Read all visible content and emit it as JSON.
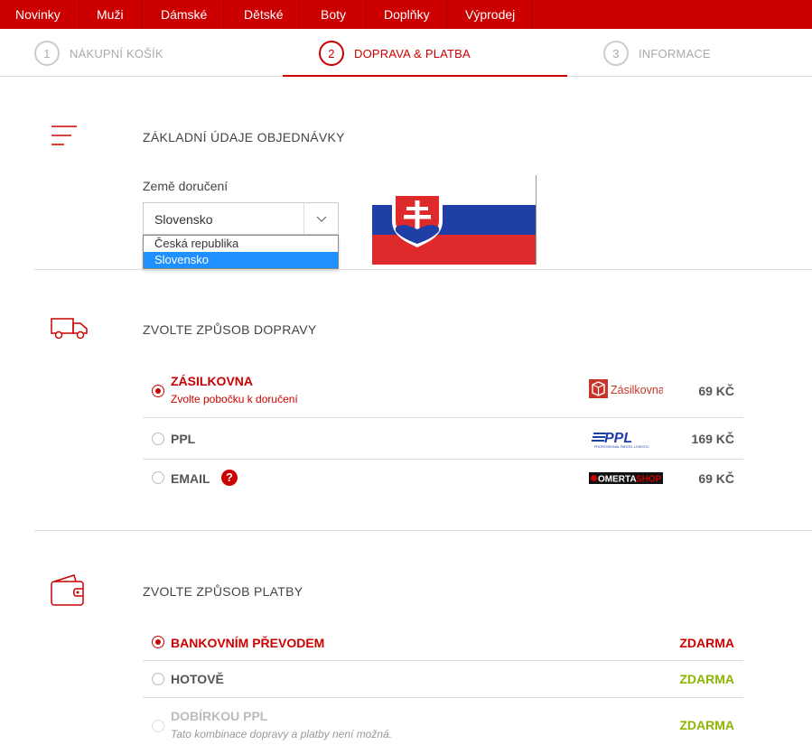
{
  "nav": {
    "items": [
      "Novinky",
      "Muži",
      "Dámské",
      "Dětské",
      "Boty",
      "Doplňky",
      "Výprodej"
    ]
  },
  "steps": [
    {
      "number": "1",
      "label": "NÁKUPNÍ KOŠÍK",
      "active": false
    },
    {
      "number": "2",
      "label": "DOPRAVA & PLATBA",
      "active": true
    },
    {
      "number": "3",
      "label": "INFORMACE",
      "active": false
    }
  ],
  "basic": {
    "title": "ZÁKLADNÍ ÚDAJE OBJEDNÁVKY",
    "country_label": "Země doručení",
    "country_value": "Slovensko",
    "options": [
      "Česká republika",
      "Slovensko"
    ],
    "selected_option": "Slovensko"
  },
  "shipping": {
    "title": "ZVOLTE ZPŮSOB DOPRAVY",
    "options": [
      {
        "label": "ZÁSILKOVNA",
        "sub": "Zvolte pobočku k doručení",
        "logo": "Zásilkovna",
        "price": "69 KČ",
        "selected": true
      },
      {
        "label": "PPL",
        "logo": "PPL",
        "logo_sub": "PROFESSIONAL PARCEL LOGISTIC",
        "price": "169 KČ",
        "selected": false
      },
      {
        "label": "EMAIL",
        "help": "?",
        "logo_a": "OMERTA",
        "logo_b": "SHOP",
        "price": "69 KČ",
        "selected": false
      }
    ]
  },
  "payment": {
    "title": "ZVOLTE ZPŮSOB PLATBY",
    "options": [
      {
        "label": "BANKOVNÍM PŘEVODEM",
        "price": "ZDARMA",
        "selected": true
      },
      {
        "label": "HOTOVĚ",
        "price": "ZDARMA",
        "selected": false
      },
      {
        "label": "DOBÍRKOU PPL",
        "sub": "Tato kombinace dopravy a platby není možná.",
        "price": "ZDARMA",
        "disabled": true
      }
    ]
  },
  "colors": {
    "brand": "#cc0000",
    "free": "#8cb400",
    "select_highlight": "#1e90ff"
  }
}
